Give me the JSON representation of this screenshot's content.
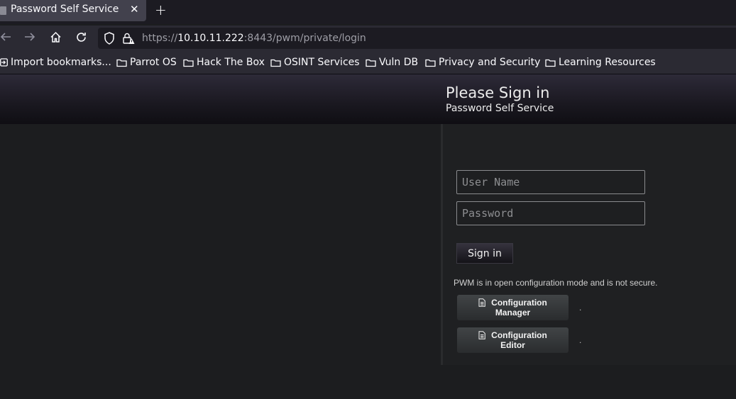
{
  "browser": {
    "tab_title": "Password Self Service",
    "url_scheme_prefix": "https://",
    "url_host": "10.10.11.222",
    "url_rest": ":8443/pwm/private/login"
  },
  "bookmarks": [
    {
      "label": "Import bookmarks...",
      "icon": "import-icon"
    },
    {
      "label": "Parrot OS",
      "icon": "folder-icon"
    },
    {
      "label": "Hack The Box",
      "icon": "folder-icon"
    },
    {
      "label": "OSINT Services",
      "icon": "folder-icon"
    },
    {
      "label": "Vuln DB",
      "icon": "folder-icon"
    },
    {
      "label": "Privacy and Security",
      "icon": "folder-icon"
    },
    {
      "label": "Learning Resources",
      "icon": "folder-icon"
    }
  ],
  "header": {
    "title": "Please Sign in",
    "subtitle": "Password Self Service"
  },
  "login": {
    "username_placeholder": "User Name",
    "password_placeholder": "Password",
    "signin_label": "Sign in"
  },
  "config": {
    "warning": "PWM is in open configuration mode and is not secure.",
    "manager_line1": "Configuration",
    "manager_line2": "Manager",
    "editor_line1": "Configuration",
    "editor_line2": "Editor",
    "separator": "."
  }
}
